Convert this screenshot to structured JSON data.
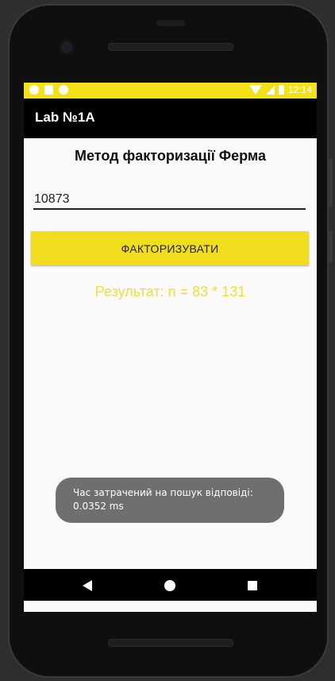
{
  "status_bar": {
    "time": "12:14",
    "left_icons": [
      "shield-icon",
      "sim-card-icon",
      "settings-icon"
    ],
    "right_icons": [
      "wifi-icon",
      "signal-icon",
      "battery-icon"
    ],
    "color": "#f5e11a"
  },
  "app_bar": {
    "title": "Lab №1A"
  },
  "main": {
    "heading": "Метод факторизації Ферма",
    "number_input": {
      "value": "10873",
      "placeholder": ""
    },
    "factorize_button": "ФАКТОРИЗУВАТИ",
    "result_text": "Результат: n = 83 * 131"
  },
  "toast": {
    "line1": "Час затрачений на пошук відповіді:",
    "line2": "0.0352 ms"
  },
  "nav_bar": {
    "buttons": [
      "back-icon",
      "home-icon",
      "recents-icon"
    ]
  },
  "colors": {
    "accent": "#f0dd1f",
    "result": "#f2dc3a",
    "app_bar": "#000000"
  }
}
